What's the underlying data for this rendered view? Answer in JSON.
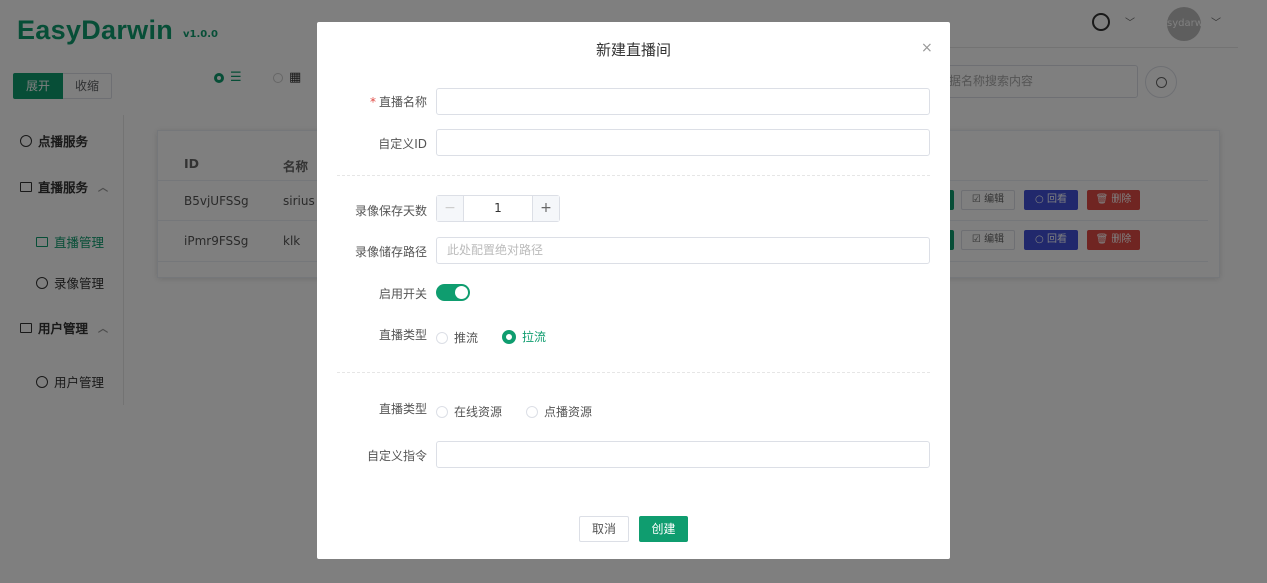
{
  "app": {
    "logo": "EasyDarwin",
    "version": "v1.0.0"
  },
  "toolbar": {
    "expand": "展开",
    "collapse": "收缩"
  },
  "view_switch": {
    "list_icon": "list-icon",
    "grid_icon": "grid-icon"
  },
  "sidebar": {
    "vod_service": "点播服务",
    "live_service": "直播服务",
    "live_manage": "直播管理",
    "record_manage": "录像管理",
    "user_group": "用户管理",
    "user_manage": "用户管理"
  },
  "header": {
    "avatar_text": "sydarw",
    "gauge_icon": "gauge-icon"
  },
  "search": {
    "placeholder": "据名称搜索内容"
  },
  "table": {
    "headers": [
      "ID",
      "名称"
    ],
    "rows": [
      {
        "id": "B5vjUFSSg",
        "name": "sirius"
      },
      {
        "id": "iPmr9FSSg",
        "name": "klk"
      }
    ],
    "actions": {
      "edit": "☑ 编辑",
      "playback": "○ 回看",
      "delete": "🗑 删除"
    }
  },
  "modal": {
    "title": "新建直播间",
    "close": "×",
    "fields": {
      "name_label": "直播名称",
      "name_required": "*",
      "custom_id_label": "自定义ID",
      "record_days_label": "录像保存天数",
      "record_days_value": "1",
      "record_days_minus": "−",
      "record_days_plus": "+",
      "record_path_label": "录像储存路径",
      "record_path_placeholder": "此处配置绝对路径",
      "enable_label": "启用开关",
      "enable_on": true,
      "live_type_label": "直播类型",
      "live_type_push": "推流",
      "live_type_pull": "拉流",
      "live_type_selected": "拉流",
      "source_type_label": "直播类型",
      "source_online": "在线资源",
      "source_vod": "点播资源",
      "custom_cmd_label": "自定义指令"
    },
    "buttons": {
      "cancel": "取消",
      "create": "创建"
    }
  },
  "colors": {
    "brand": "#0f9d6f",
    "playback": "#4250d9",
    "danger": "#e04a44"
  }
}
